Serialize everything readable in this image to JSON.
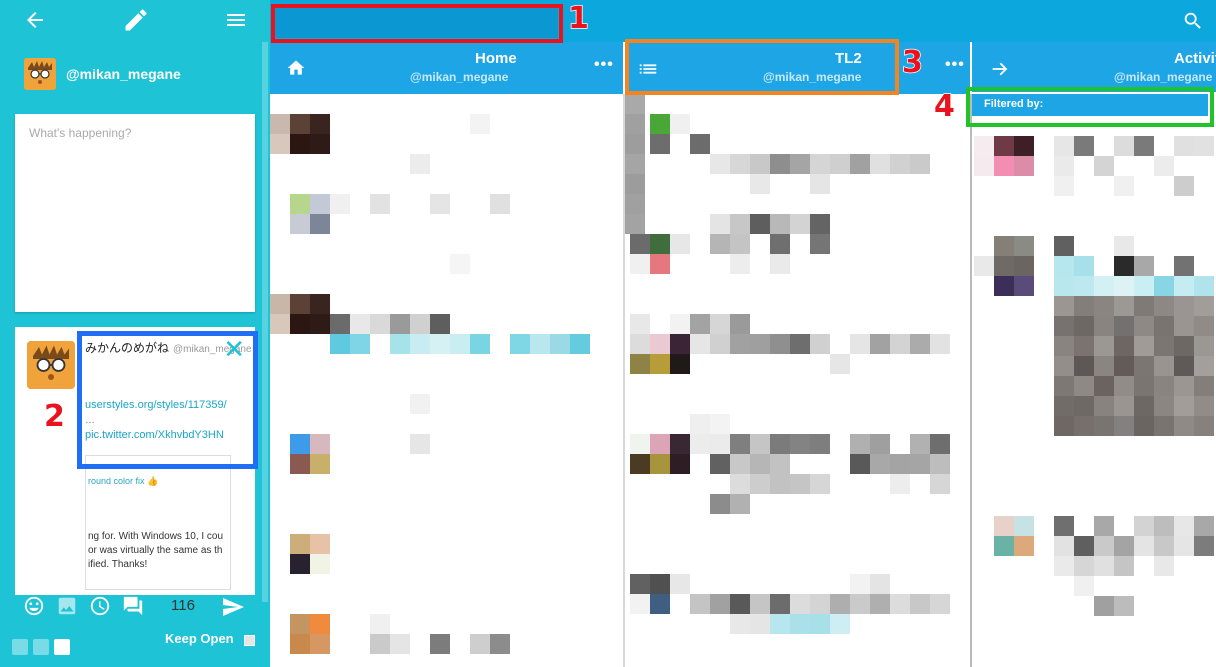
{
  "sidebar": {
    "account_handle": "@mikan_megane",
    "compose_placeholder": "What's happening?",
    "preview": {
      "display_name": "みかんのめがね",
      "handle": "@mikan_megane",
      "link1": "userstyles.org/styles/117359/",
      "ellipsis": "…",
      "link2": "pic.twitter.com/XkhvbdY3HN",
      "card_line1": "round color fix 👍",
      "card_line2": "ng for. With Windows 10, I cou\nor was virtually the same as th\nified. Thanks!"
    },
    "char_count": "116",
    "keep_open_label": "Keep Open"
  },
  "columns": [
    {
      "title": "Home",
      "subtitle": "@mikan_megane",
      "icon": "home-icon",
      "more": "•••"
    },
    {
      "title": "TL2",
      "subtitle": "@mikan_megane",
      "icon": "list-icon",
      "more": "•••"
    },
    {
      "title": "Activity",
      "subtitle": "@mikan_megane",
      "icon": "arrow-right-icon"
    }
  ],
  "filter": {
    "label": "Filtered by:"
  },
  "annotations": [
    {
      "label": "1",
      "color": "#e8131c"
    },
    {
      "label": "2",
      "color": "#1f6ef5"
    },
    {
      "label": "3",
      "color": "#f2851f"
    },
    {
      "label": "4",
      "color": "#22c22a"
    }
  ],
  "colors": {
    "sidebar": "#1ec3d6",
    "topbar": "#0ca7dc",
    "column_header": "#1ea5e5"
  }
}
